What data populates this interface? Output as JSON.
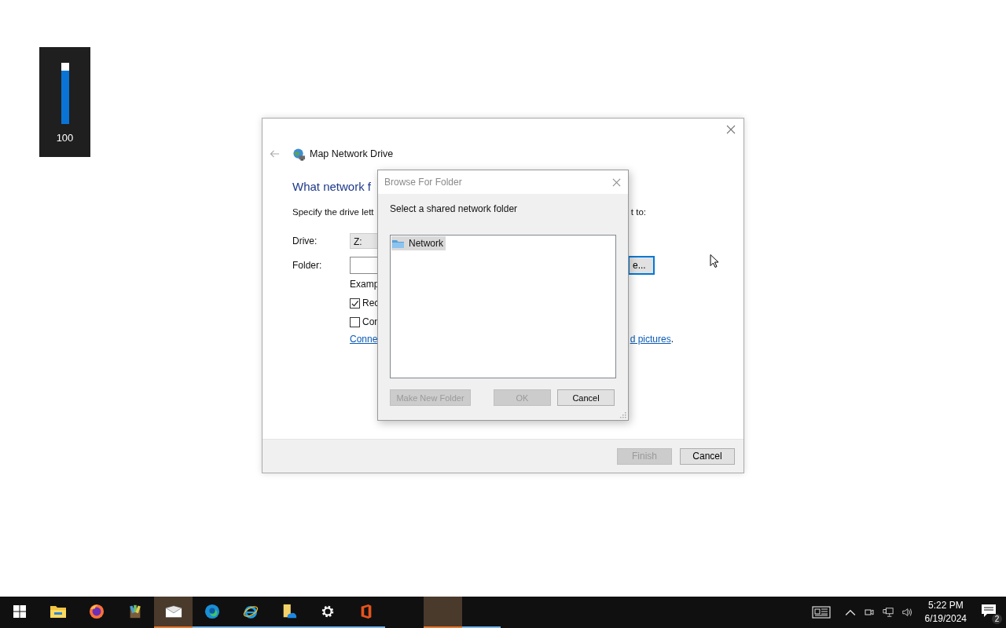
{
  "volume_osd": {
    "level": 1,
    "reading": "100"
  },
  "wizard": {
    "title": "Map Network Drive",
    "heading": "What network f",
    "instruction": [
      "Specify the drive lett",
      "t to:"
    ],
    "drive": {
      "label": "Drive:",
      "value": "Z:"
    },
    "folder": {
      "label": "Folder:",
      "browse_button": "e..."
    },
    "example": "Examp",
    "checkboxes": [
      {
        "label": "Rec",
        "checked": true
      },
      {
        "label": "Con",
        "checked": false
      }
    ],
    "link": [
      "Conne",
      "d pictures"
    ],
    "link_end": ".",
    "buttons": [
      {
        "label": "Finish",
        "disabled": true
      },
      {
        "label": "Cancel",
        "disabled": false
      }
    ]
  },
  "browse_dialog": {
    "title": "Browse For Folder",
    "prompt": "Select a shared network folder",
    "tree": [
      {
        "label": "Network",
        "selected": true
      }
    ],
    "buttons": [
      {
        "label": "Make New Folder",
        "disabled": true
      },
      {
        "label": "OK",
        "disabled": true
      },
      {
        "label": "Cancel",
        "disabled": false
      }
    ]
  },
  "taskbar": {
    "apps": [
      {
        "kind": "explorer",
        "running": false,
        "active": false
      },
      {
        "kind": "firefox",
        "running": false,
        "active": false
      },
      {
        "kind": "archiver",
        "running": false,
        "active": false
      },
      {
        "kind": "mail",
        "running": true,
        "active": true
      },
      {
        "kind": "edge",
        "running": true,
        "active": false
      },
      {
        "kind": "ie",
        "running": true,
        "active": false
      },
      {
        "kind": "cloudfolder",
        "running": true,
        "active": false
      },
      {
        "kind": "settings",
        "running": true,
        "active": false
      },
      {
        "kind": "office",
        "running": true,
        "active": false
      },
      {
        "kind": "blank",
        "running": true,
        "active": true
      },
      {
        "kind": "blank",
        "running": true,
        "active": false
      }
    ],
    "time": "5:22 PM",
    "date": "6/19/2024",
    "notification_count": "2"
  }
}
